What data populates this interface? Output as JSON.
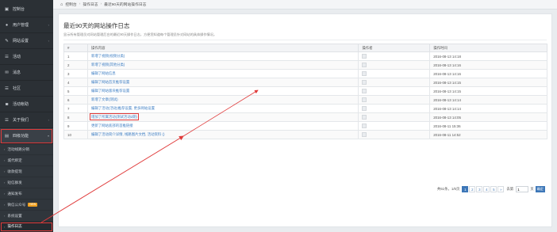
{
  "sidebar": {
    "items": [
      {
        "label": "控制台",
        "icon": "dashboard-icon",
        "glyph": "▣"
      },
      {
        "label": "用户管理",
        "icon": "user-icon",
        "glyph": "●",
        "caret": "‹"
      },
      {
        "label": "网站设置",
        "icon": "wrench-icon",
        "glyph": "✎",
        "caret": "‹"
      },
      {
        "label": "活动",
        "icon": "list-icon",
        "glyph": "☰"
      },
      {
        "label": "消息",
        "icon": "message-icon",
        "glyph": "✉"
      },
      {
        "label": "社区",
        "icon": "community-icon",
        "glyph": "☰"
      },
      {
        "label": "活动帐助",
        "icon": "camera-icon",
        "glyph": "◙"
      },
      {
        "label": "关于我们",
        "icon": "about-icon",
        "glyph": "☰",
        "caret": "‹"
      },
      {
        "label": "四级功能",
        "icon": "feature-icon",
        "glyph": "▤",
        "caret": "▾"
      }
    ],
    "sub_items": [
      {
        "label": "活动线路分销"
      },
      {
        "label": "城代绑定"
      },
      {
        "label": "收款提现"
      },
      {
        "label": "短信群发"
      },
      {
        "label": "通知发布"
      },
      {
        "label": "微信公众号",
        "badge": "NEW"
      },
      {
        "label": "系统设置"
      },
      {
        "label": "操作日志"
      }
    ]
  },
  "breadcrumb": {
    "home_glyph": "⌂",
    "items": [
      "控制台",
      "操作日志",
      "最近90天的网站操作日志"
    ]
  },
  "main": {
    "title": "最近90天的网站操作日志",
    "description": "显示所有管理员对网站管理后台的最近90天操作日志，方便您知道每个管理员针对网站的具体操作情况。",
    "table": {
      "headers": [
        "#",
        "操作内容",
        "操作者",
        "操作时间"
      ],
      "rows": [
        {
          "num": "1",
          "content": "新增了视频(视频分类)",
          "time": "2016-08-13 14:18"
        },
        {
          "num": "2",
          "content": "新增了视频(其他分类)",
          "time": "2016-08-13 14:16"
        },
        {
          "num": "3",
          "content": "编辑了网站信息",
          "time": "2016-08-13 14:16"
        },
        {
          "num": "4",
          "content": "编辑了网站首页推荐设置",
          "time": "2016-08-13 14:15"
        },
        {
          "num": "5",
          "content": "编辑了网站版块推荐设置",
          "time": "2016-08-13 14:15"
        },
        {
          "num": "6",
          "content": "新增了文章(测试)",
          "time": "2016-08-13 14:14"
        },
        {
          "num": "7",
          "content": "编辑了活动(活动)推荐设置, 更多网站设置",
          "time": "2016-08-13 14:14"
        },
        {
          "num": "8",
          "content": "增加了所属活动(测试活动2期)",
          "time": "2016-08-13 14:05"
        },
        {
          "num": "9",
          "content": "更新了网站底部的首推链接",
          "time": "2016-08-11 15:36"
        },
        {
          "num": "10",
          "content": "编辑了活动简介详情, 线路图片文档, 活动资料 ()",
          "time": "2016-08-11 14:52"
        }
      ]
    },
    "pagination": {
      "summary": "共51条，1/6页",
      "pages": [
        "1",
        "2",
        "3",
        "4",
        "5"
      ],
      "current": "1",
      "next": "»",
      "goto_label": "去第",
      "goto_value": "1",
      "goto_unit": "页",
      "goto_button": "确定"
    }
  },
  "colors": {
    "sidebar_bg": "#2b3035",
    "accent": "#3d77b8",
    "link": "#3f7fc4",
    "annotation": "#e03a3a"
  }
}
